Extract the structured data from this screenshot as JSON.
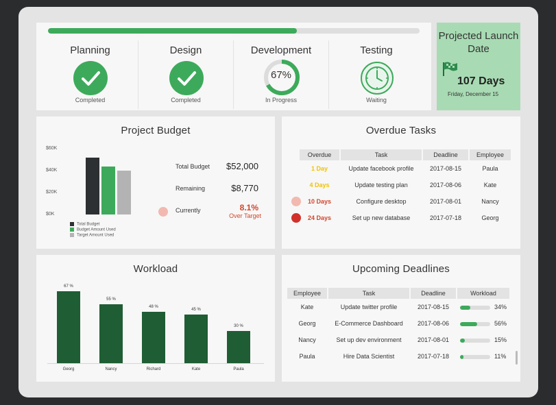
{
  "phases": {
    "overall_progress_percent": 67,
    "items": [
      {
        "name": "Planning",
        "status": "Completed",
        "icon": "check-icon"
      },
      {
        "name": "Design",
        "status": "Completed",
        "icon": "check-icon"
      },
      {
        "name": "Development",
        "status": "In Progress",
        "percent": 67,
        "percent_label": "67%"
      },
      {
        "name": "Testing",
        "status": "Waiting",
        "icon": "clock-icon"
      }
    ]
  },
  "launch": {
    "title": "Projected Launch Date",
    "days": "107 Days",
    "date": "Friday, December 15",
    "icon": "flag-icon"
  },
  "budget": {
    "title": "Project Budget",
    "y_ticks": [
      "$60K",
      "$40K",
      "$20K",
      "$0K"
    ],
    "chart_data": {
      "type": "bar",
      "categories": [
        "Total Budget",
        "Budget Amount Used",
        "Target Amount Used"
      ],
      "values": [
        52,
        43.5,
        40
      ],
      "ylim": [
        0,
        60
      ],
      "colors": [
        "#2d3033",
        "#3daa5b",
        "#b3b3b3"
      ]
    },
    "legend": [
      "Total Budget",
      "Budget Amount Used",
      "Target Amount Used"
    ],
    "total_label": "Total Budget",
    "total_value": "$52,000",
    "remaining_label": "Remaining",
    "remaining_value": "$8,770",
    "currently_label": "Currently",
    "currently_pct": "8.1%",
    "currently_note": "Over Target"
  },
  "overdue": {
    "title": "Overdue Tasks",
    "columns": [
      "Overdue",
      "Task",
      "Deadline",
      "Employee"
    ],
    "rows": [
      {
        "overdue": "1 Day",
        "task": "Update facebook profile",
        "deadline": "2017-08-15",
        "employee": "Paula",
        "color": "#f2c200",
        "dot": ""
      },
      {
        "overdue": "4 Days",
        "task": "Update testing plan",
        "deadline": "2017-08-06",
        "employee": "Kate",
        "color": "#f2c200",
        "dot": ""
      },
      {
        "overdue": "10 Days",
        "task": "Configure desktop",
        "deadline": "2017-08-01",
        "employee": "Nancy",
        "color": "#d2452b",
        "dot": "#f2b9b0"
      },
      {
        "overdue": "24 Days",
        "task": "Set up new database",
        "deadline": "2017-07-18",
        "employee": "Georg",
        "color": "#d2452b",
        "dot": "#d1312a"
      }
    ]
  },
  "workload": {
    "title": "Workload",
    "chart_data": {
      "type": "bar",
      "categories": [
        "Georg",
        "Nancy",
        "Richard",
        "Kate",
        "Paula"
      ],
      "values": [
        67,
        55,
        48,
        45,
        30
      ],
      "labels": [
        "67 %",
        "55 %",
        "48 %",
        "45 %",
        "30 %"
      ],
      "ylim": [
        0,
        70
      ]
    }
  },
  "deadlines": {
    "title": "Upcoming Deadlines",
    "columns": [
      "Employee",
      "Task",
      "Deadline",
      "Workload"
    ],
    "rows": [
      {
        "employee": "Kate",
        "task": "Update twitter profile",
        "deadline": "2017-08-15",
        "workload": 34,
        "workload_label": "34%"
      },
      {
        "employee": "Georg",
        "task": "E-Commerce Dashboard",
        "deadline": "2017-08-06",
        "workload": 56,
        "workload_label": "56%"
      },
      {
        "employee": "Nancy",
        "task": "Set up dev environment",
        "deadline": "2017-08-01",
        "workload": 15,
        "workload_label": "15%"
      },
      {
        "employee": "Paula",
        "task": "Hire Data Scientist",
        "deadline": "2017-07-18",
        "workload": 11,
        "workload_label": "11%"
      }
    ]
  }
}
